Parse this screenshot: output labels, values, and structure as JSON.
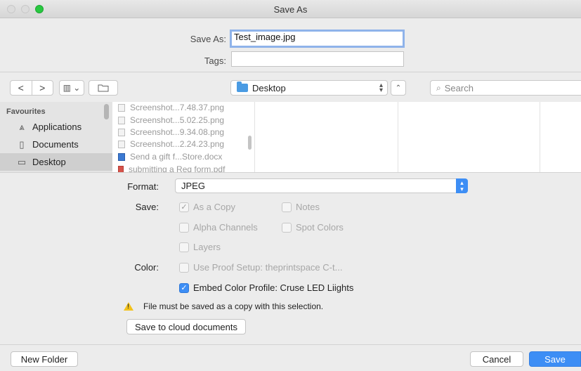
{
  "window": {
    "title": "Save As"
  },
  "form": {
    "save_as_label": "Save As:",
    "filename": "Test_image.jpg",
    "tags_label": "Tags:",
    "tags_value": ""
  },
  "toolbar": {
    "back": "<",
    "forward": ">",
    "view": "▥ ⌄",
    "location": "Desktop",
    "search_placeholder": "Search"
  },
  "sidebar": {
    "header": "Favourites",
    "items": [
      {
        "label": "Applications",
        "icon": "applications-icon"
      },
      {
        "label": "Documents",
        "icon": "documents-icon"
      },
      {
        "label": "Desktop",
        "icon": "desktop-icon"
      }
    ]
  },
  "files": [
    {
      "name": "Screenshot...7.48.37.png",
      "type": "png"
    },
    {
      "name": "Screenshot...5.02.25.png",
      "type": "png"
    },
    {
      "name": "Screenshot...9.34.08.png",
      "type": "png"
    },
    {
      "name": "Screenshot...2.24.23.png",
      "type": "png"
    },
    {
      "name": "Send a gift f...Store.docx",
      "type": "docx"
    },
    {
      "name": "submitting a Req form.pdf",
      "type": "pdf"
    }
  ],
  "options": {
    "format_label": "Format:",
    "format_value": "JPEG",
    "save_label": "Save:",
    "as_a_copy": "As a Copy",
    "notes": "Notes",
    "alpha_channels": "Alpha Channels",
    "spot_colors": "Spot Colors",
    "layers": "Layers",
    "color_label": "Color:",
    "use_proof_setup": "Use Proof Setup:  theprintspace C-t...",
    "embed_color_profile": "Embed Color Profile:  Cruse LED Liights",
    "warning": "File must be saved as a copy with this selection.",
    "cloud_button": "Save to cloud documents"
  },
  "footer": {
    "new_folder": "New Folder",
    "cancel": "Cancel",
    "save": "Save"
  },
  "colors": {
    "accent": "#3d8ef5",
    "warning": "#f3c21a"
  }
}
